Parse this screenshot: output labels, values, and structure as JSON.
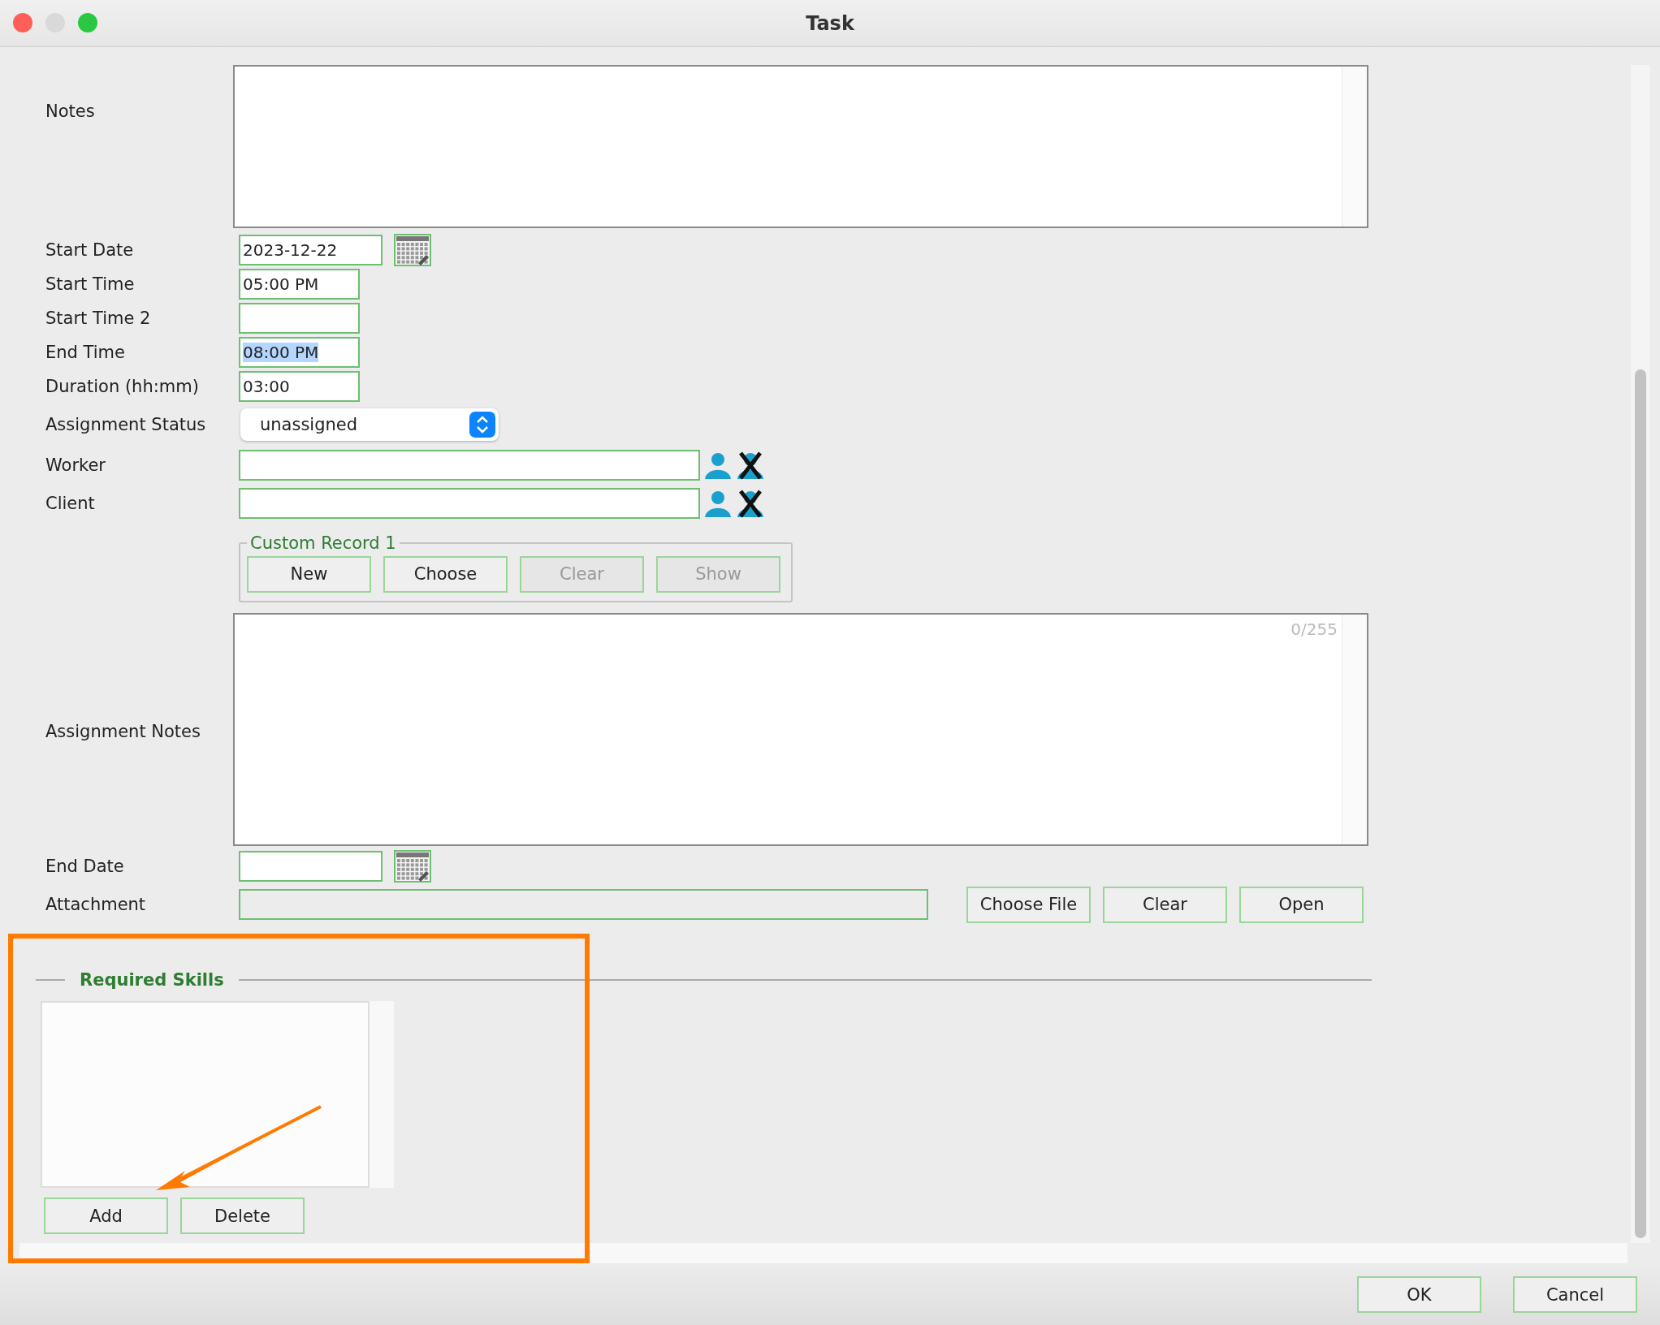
{
  "window": {
    "title": "Task"
  },
  "form": {
    "rows": [
      {
        "kind": "textarea",
        "label": "Notes"
      },
      {
        "kind": "date",
        "label": "Start Date",
        "value": "2023-12-22",
        "text_selected": false
      },
      {
        "kind": "time",
        "label": "Start Time",
        "value": "05:00 PM",
        "text_selected": false
      },
      {
        "kind": "time",
        "label": "Start Time 2"
      },
      {
        "kind": "time",
        "label": "End Time",
        "value": "08:00 PM",
        "text_selected": true
      },
      {
        "kind": "time",
        "label": "Duration (hh:mm)",
        "value": "03:00",
        "text_selected": false
      },
      {
        "kind": "select",
        "label": "Assignment Status",
        "value": "unassigned"
      },
      {
        "kind": "lookup",
        "label": "Worker"
      },
      {
        "kind": "lookup",
        "label": "Client"
      },
      {
        "kind": "group",
        "legend": "Custom Record 1",
        "buttons": [
          {
            "label": "New",
            "disabled": false
          },
          {
            "label": "Choose",
            "disabled": false
          },
          {
            "label": "Clear",
            "disabled": true
          },
          {
            "label": "Show",
            "disabled": true
          }
        ]
      },
      {
        "kind": "textarea",
        "label": "Assignment Notes",
        "counter": "0/255"
      },
      {
        "kind": "date",
        "label": "End Date"
      },
      {
        "kind": "file",
        "label": "Attachment",
        "buttons": [
          {
            "label": "Choose File",
            "disabled": false
          },
          {
            "label": "Clear",
            "disabled": false
          },
          {
            "label": "Open",
            "disabled": false
          }
        ]
      }
    ]
  },
  "required_skills": {
    "title": "Required Skills",
    "buttons": [
      {
        "label": "Add",
        "disabled": false
      },
      {
        "label": "Delete",
        "disabled": false
      }
    ]
  },
  "footer": {
    "buttons": [
      {
        "label": "OK",
        "disabled": false
      },
      {
        "label": "Cancel",
        "disabled": false
      }
    ]
  }
}
